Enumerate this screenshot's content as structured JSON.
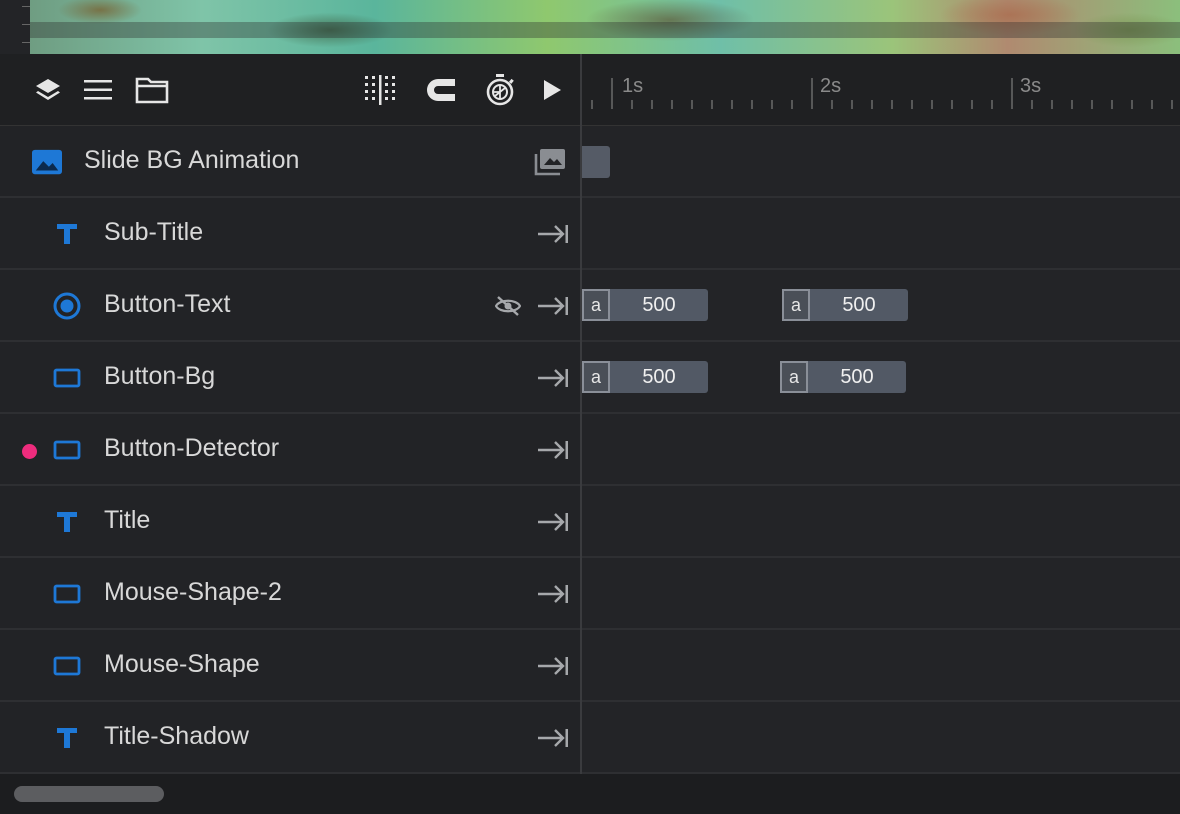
{
  "toolbar": {
    "icons": [
      "layers-icon",
      "list-icon",
      "folder-icon",
      "grid-snap-icon",
      "magnet-icon",
      "stopwatch-icon",
      "play-icon"
    ]
  },
  "ruler": {
    "labels": [
      "1s",
      "2s",
      "3s"
    ]
  },
  "layers": [
    {
      "label": "Slide BG Animation",
      "type": "image"
    },
    {
      "label": "Sub-Title",
      "type": "text"
    },
    {
      "label": "Button-Text",
      "type": "radio",
      "hidden_icon": true
    },
    {
      "label": "Button-Bg",
      "type": "shape"
    },
    {
      "label": "Button-Detector",
      "type": "shape",
      "marker": true
    },
    {
      "label": "Title",
      "type": "text"
    },
    {
      "label": "Mouse-Shape-2",
      "type": "shape"
    },
    {
      "label": "Mouse-Shape",
      "type": "shape"
    },
    {
      "label": "Title-Shadow",
      "type": "text"
    }
  ],
  "tracks": {
    "button_text": [
      {
        "tag": "a",
        "value": "500"
      },
      {
        "tag": "a",
        "value": "500"
      }
    ],
    "button_bg": [
      {
        "tag": "a",
        "value": "500"
      },
      {
        "tag": "a",
        "value": "500"
      }
    ]
  },
  "colors": {
    "accent": "#1e78d6",
    "marker": "#ee2c7d",
    "segment": "#525965"
  }
}
